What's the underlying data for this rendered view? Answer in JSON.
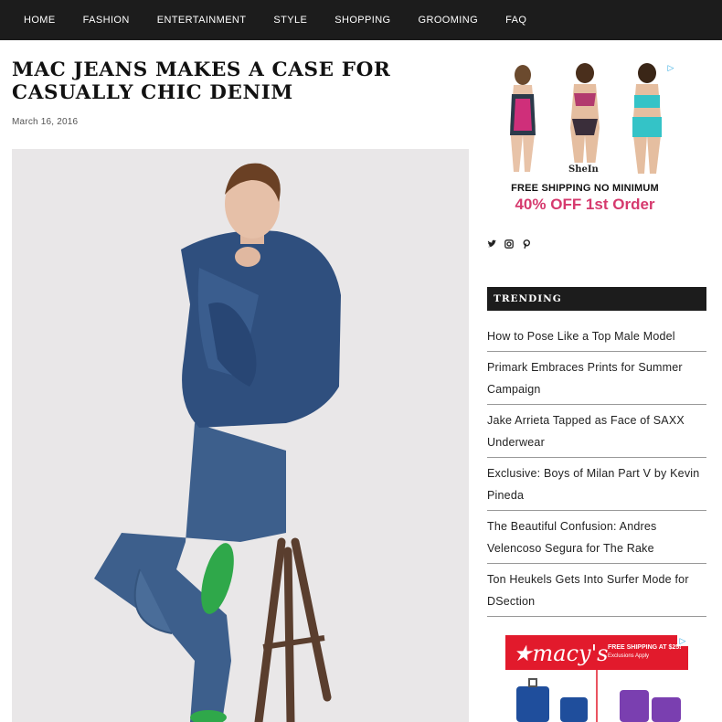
{
  "nav": {
    "items": [
      "HOME",
      "FASHION",
      "ENTERTAINMENT",
      "STYLE",
      "SHOPPING",
      "GROOMING",
      "FAQ"
    ]
  },
  "article": {
    "title": "MAC JEANS MAKES A CASE FOR CASUALLY CHIC DENIM",
    "date": "March 16, 2016"
  },
  "ad_top": {
    "brand": "SheIn",
    "shipping": "FREE SHIPPING NO MINIMUM",
    "offer": "40% OFF 1st Order",
    "adchoice_icon": "adchoices-icon"
  },
  "social": {
    "icons": [
      "twitter-icon",
      "instagram-icon",
      "pinterest-icon"
    ]
  },
  "trending": {
    "heading": "TRENDING",
    "items": [
      "How to Pose Like a Top Male Model",
      "Primark Embraces Prints for Summer Campaign",
      "Jake Arrieta Tapped as Face of SAXX Underwear",
      "Exclusive: Boys of Milan Part V by Kevin Pineda",
      "The Beautiful Confusion: Andres Velencoso Segura for The Rake",
      "Ton Heukels Gets Into Surfer Mode for DSection"
    ]
  },
  "ad_bottom": {
    "brand": "macy's",
    "shipping": "FREE SHIPPING AT $25!",
    "exclusions": "Exclusions Apply"
  },
  "colors": {
    "nav_bg": "#1c1c1c",
    "offer_pink": "#d63a6e",
    "macys_red": "#e21a2c"
  }
}
